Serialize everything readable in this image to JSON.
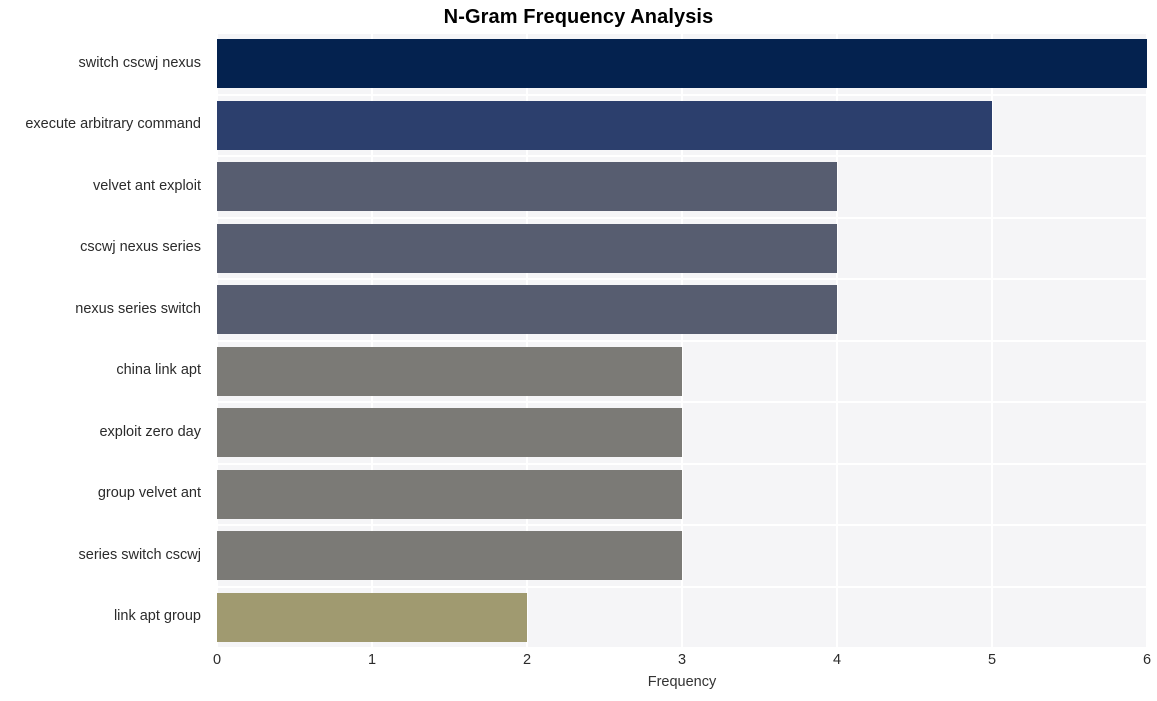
{
  "chart_data": {
    "type": "bar",
    "orientation": "horizontal",
    "title": "N-Gram Frequency Analysis",
    "xlabel": "Frequency",
    "ylabel": "",
    "categories": [
      "switch cscwj nexus",
      "execute arbitrary command",
      "velvet ant exploit",
      "cscwj nexus series",
      "nexus series switch",
      "china link apt",
      "exploit zero day",
      "group velvet ant",
      "series switch cscwj",
      "link apt group"
    ],
    "values": [
      6,
      5,
      4,
      4,
      4,
      3,
      3,
      3,
      3,
      2
    ],
    "bar_colors": [
      "#04224f",
      "#2c3f6d",
      "#575d70",
      "#575d70",
      "#575d70",
      "#7b7a76",
      "#7b7a76",
      "#7b7a76",
      "#7b7a76",
      "#a09a70"
    ],
    "xlim": [
      0,
      6
    ],
    "xticks": [
      "0",
      "1",
      "2",
      "3",
      "4",
      "5",
      "6"
    ],
    "xtick_values": [
      0,
      1,
      2,
      3,
      4,
      5,
      6
    ],
    "grid": true,
    "legend": false,
    "plot_background": "#f5f5f7",
    "grid_color": "#ffffff",
    "figure_background": "#ffffff",
    "title_color": "#000000",
    "tick_label_color": "#2b2b2b",
    "axis_label_color": "#333333"
  }
}
